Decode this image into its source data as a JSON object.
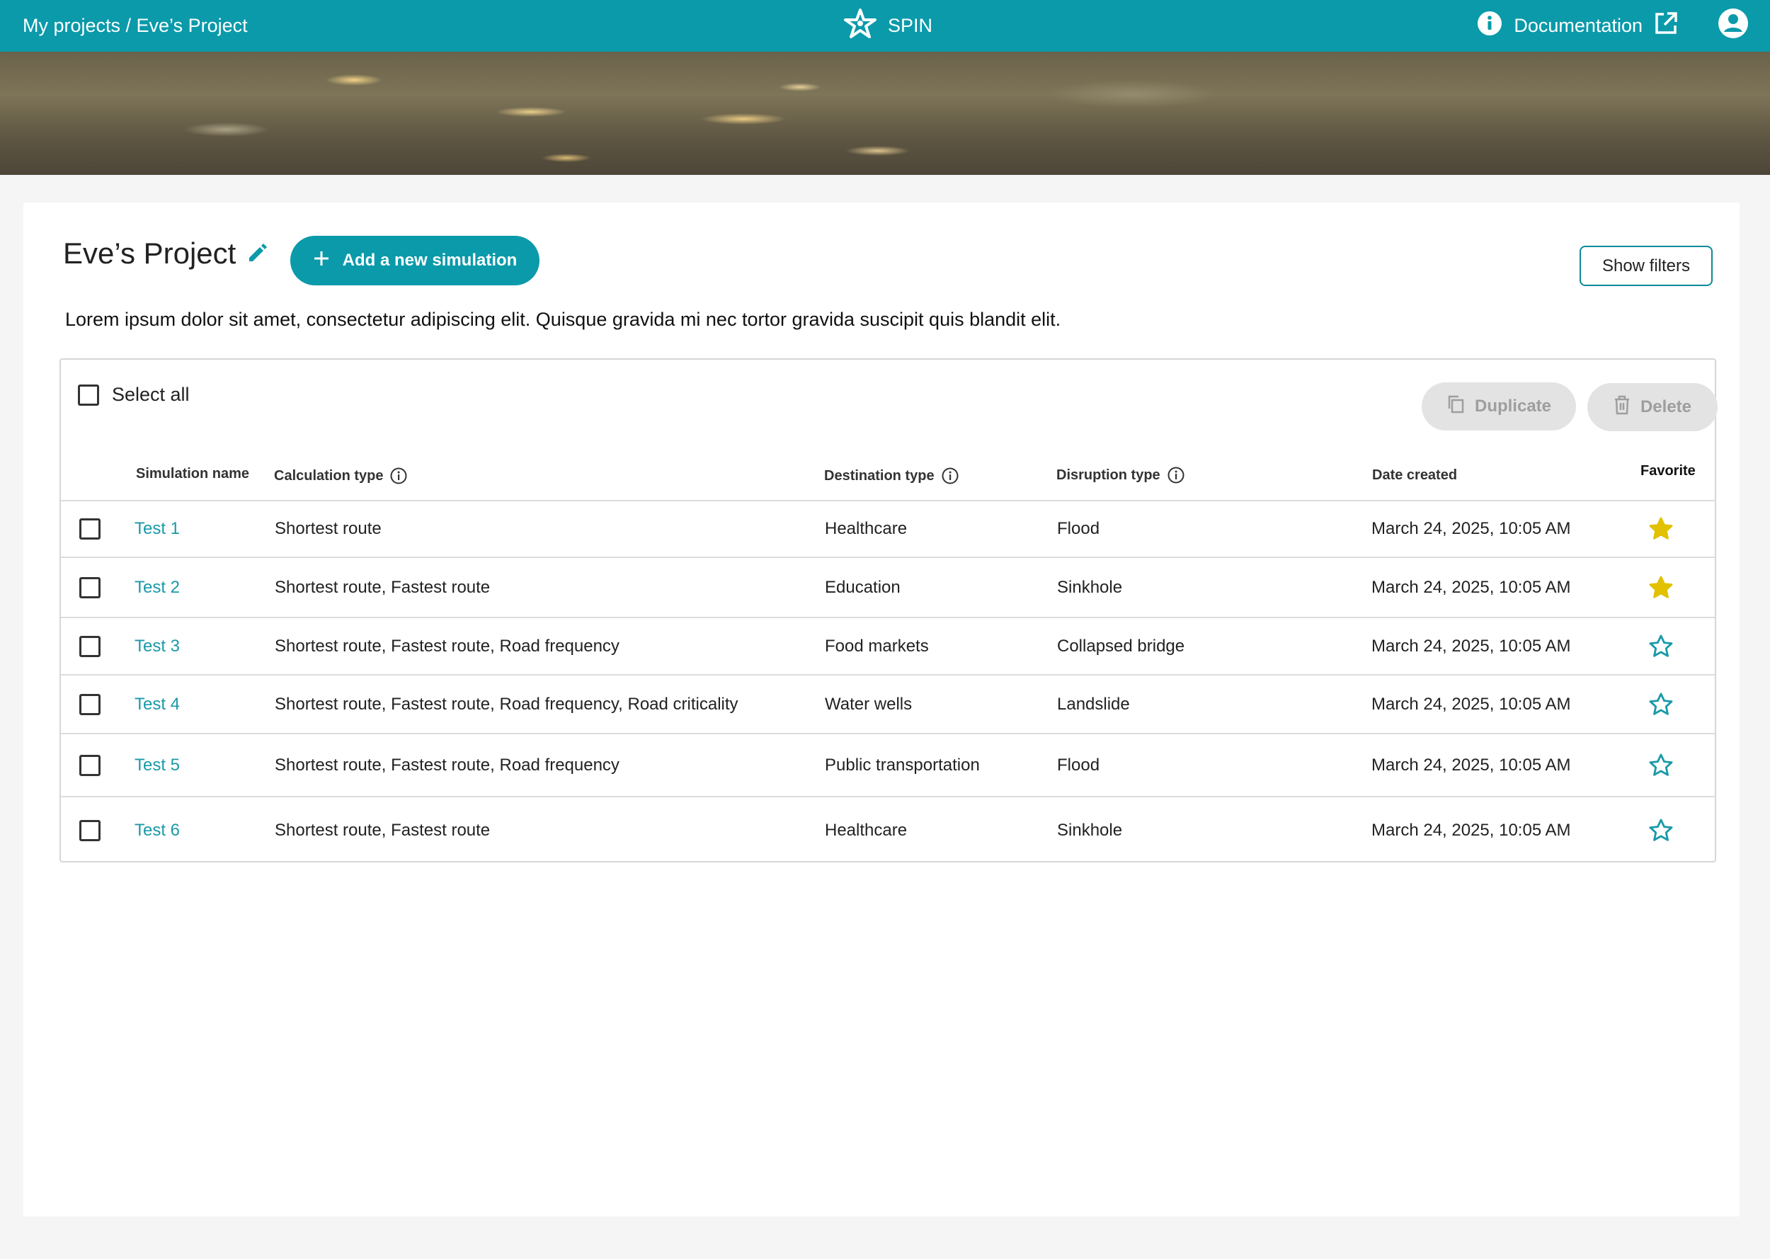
{
  "topbar": {
    "breadcrumb": "My projects / Eve’s Project",
    "brand": "SPIN",
    "documentation": "Documentation"
  },
  "project": {
    "title": "Eve’s Project",
    "add_button": "Add a new simulation",
    "filters_button": "Show filters",
    "description": "Lorem ipsum dolor sit amet, consectetur adipiscing elit. Quisque gravida mi nec tortor gravida suscipit quis blandit elit."
  },
  "table": {
    "select_all": "Select all",
    "duplicate": "Duplicate",
    "delete": "Delete",
    "headers": {
      "name": "Simulation name",
      "calc": "Calculation type",
      "dest": "Destination type",
      "disr": "Disruption type",
      "date": "Date created",
      "fav": "Favorite"
    },
    "rows": [
      {
        "name": "Test 1",
        "calc": "Shortest route",
        "dest": "Healthcare",
        "disr": "Flood",
        "date": "March 24, 2025, 10:05 AM",
        "favorite": true
      },
      {
        "name": "Test 2",
        "calc": "Shortest route, Fastest route",
        "dest": "Education",
        "disr": "Sinkhole",
        "date": "March 24, 2025, 10:05 AM",
        "favorite": true
      },
      {
        "name": "Test 3",
        "calc": "Shortest route, Fastest route, Road frequency",
        "dest": "Food markets",
        "disr": "Collapsed bridge",
        "date": "March 24, 2025, 10:05 AM",
        "favorite": false
      },
      {
        "name": "Test 4",
        "calc": "Shortest route, Fastest route, Road frequency, Road criticality",
        "dest": "Water wells",
        "disr": "Landslide",
        "date": "March 24, 2025, 10:05 AM",
        "favorite": false
      },
      {
        "name": "Test 5",
        "calc": "Shortest route, Fastest route, Road frequency",
        "dest": "Public transportation",
        "disr": "Flood",
        "date": "March 24, 2025, 10:05 AM",
        "favorite": false
      },
      {
        "name": "Test 6",
        "calc": "Shortest route, Fastest route",
        "dest": "Healthcare",
        "disr": "Sinkhole",
        "date": "March 24, 2025, 10:05 AM",
        "favorite": false
      }
    ]
  },
  "colors": {
    "accent": "#0a9aaa",
    "star_filled": "#e1c100",
    "star_outline": "#1a9aa8"
  }
}
